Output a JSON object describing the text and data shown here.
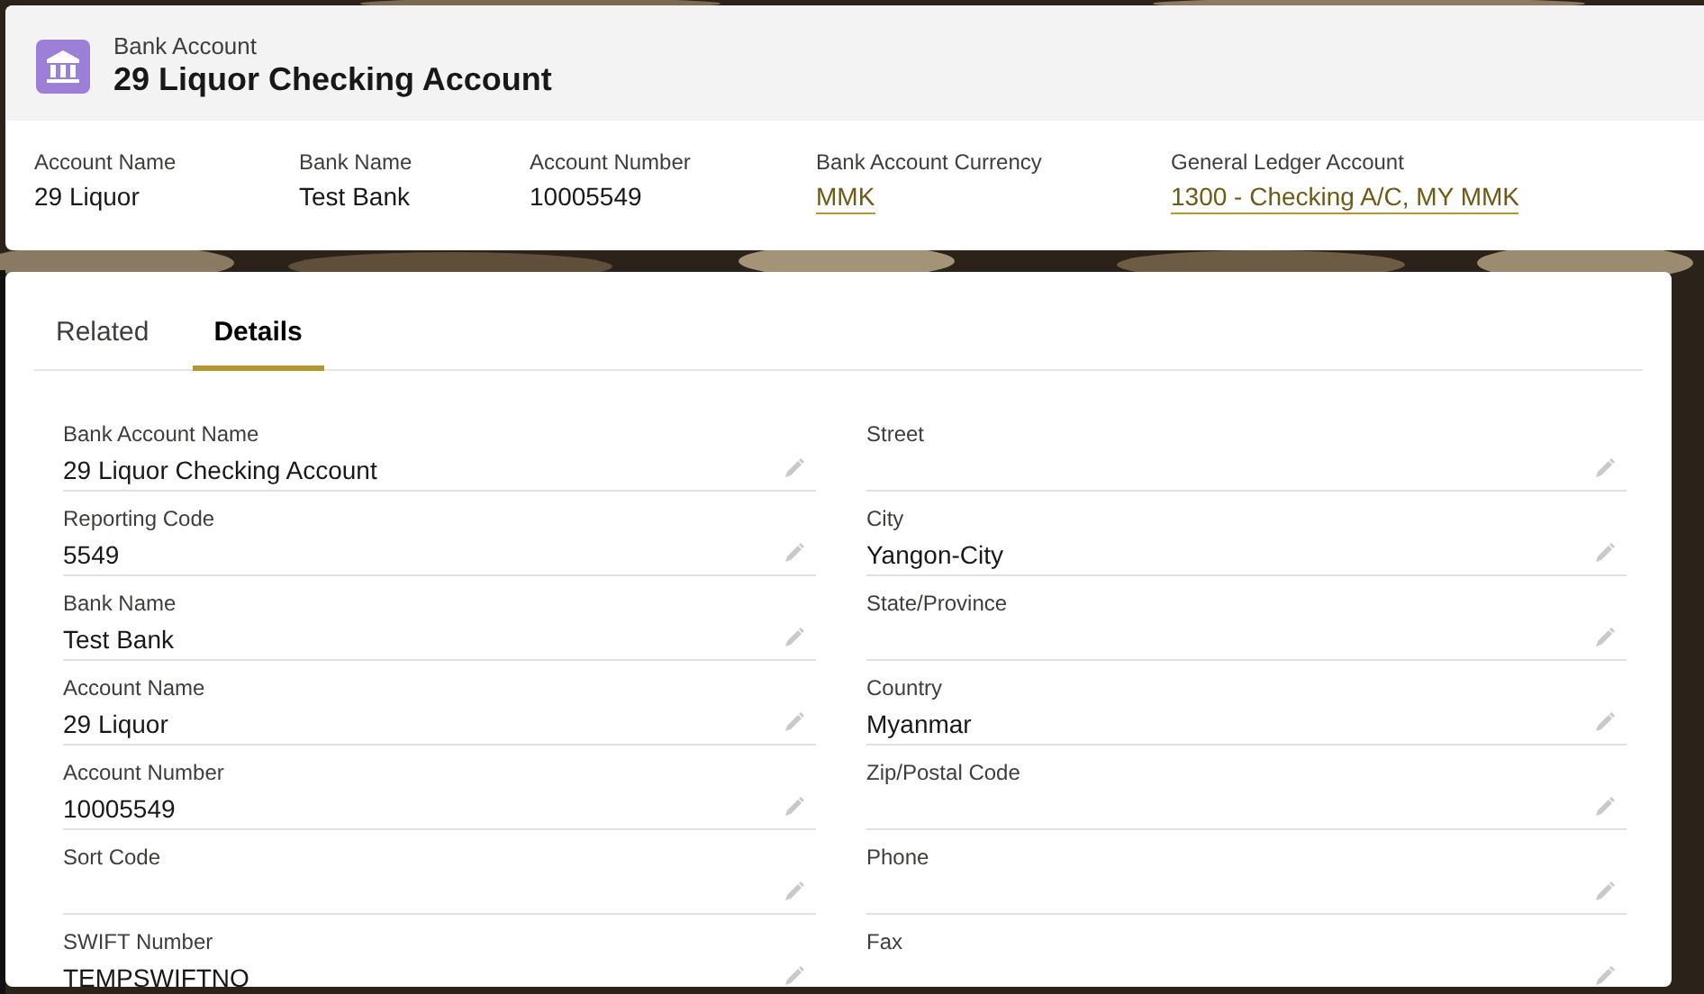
{
  "header": {
    "object_type": "Bank Account",
    "title": "29 Liquor Checking Account",
    "highlights": [
      {
        "label": "Account Name",
        "value": "29 Liquor",
        "kind": "text"
      },
      {
        "label": "Bank Name",
        "value": "Test Bank",
        "kind": "text"
      },
      {
        "label": "Account Number",
        "value": "10005549",
        "kind": "text"
      },
      {
        "label": "Bank Account Currency",
        "value": "MMK",
        "kind": "link"
      },
      {
        "label": "General Ledger Account",
        "value": "1300 - Checking A/C, MY MMK",
        "kind": "link"
      }
    ]
  },
  "tabs": [
    {
      "label": "Related",
      "selected": false
    },
    {
      "label": "Details",
      "selected": true
    }
  ],
  "details": {
    "left": [
      {
        "label": "Bank Account Name",
        "value": "29 Liquor Checking Account"
      },
      {
        "label": "Reporting Code",
        "value": "5549"
      },
      {
        "label": "Bank Name",
        "value": "Test Bank"
      },
      {
        "label": "Account Name",
        "value": "29 Liquor"
      },
      {
        "label": "Account Number",
        "value": "10005549"
      },
      {
        "label": "Sort Code"
      },
      {
        "label": "SWIFT Number",
        "value": "TEMPSWIFTNO"
      }
    ],
    "right": [
      {
        "label": "Street"
      },
      {
        "label": "City",
        "value": "Yangon-City"
      },
      {
        "label": "State/Province"
      },
      {
        "label": "Country",
        "value": "Myanmar"
      },
      {
        "label": "Zip/Postal Code"
      },
      {
        "label": "Phone"
      },
      {
        "label": "Fax"
      }
    ]
  }
}
